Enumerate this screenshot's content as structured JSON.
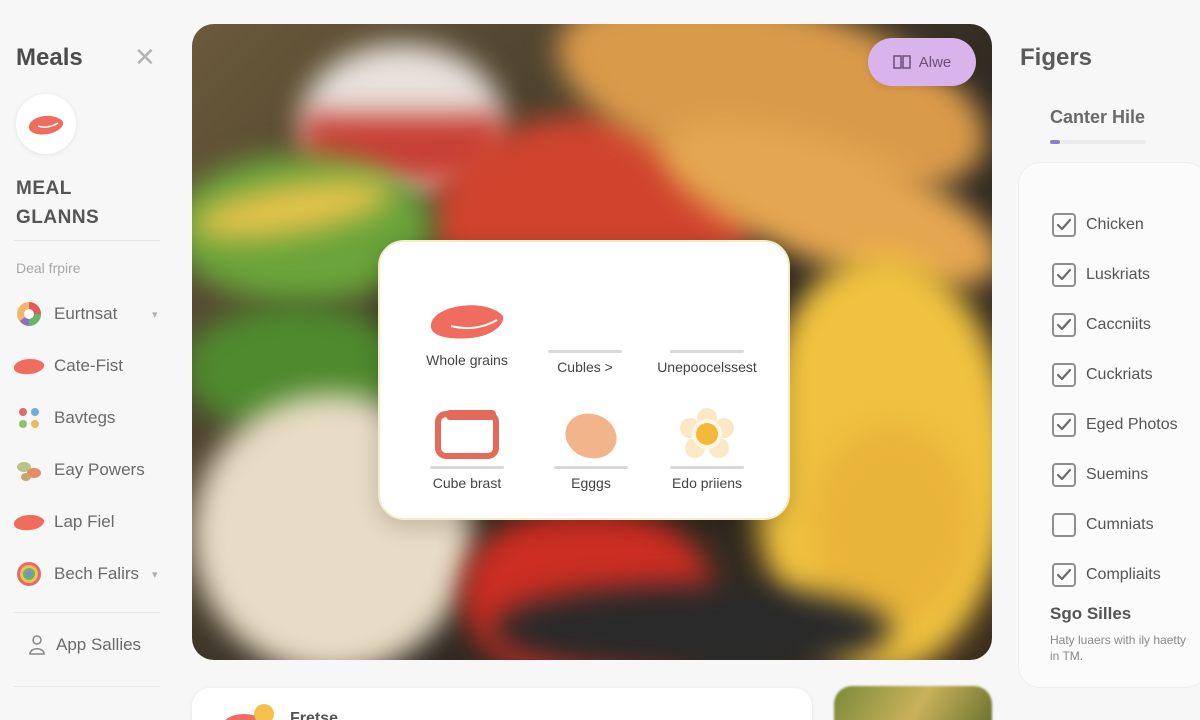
{
  "sidebar": {
    "title": "Meals",
    "heading": "MEAL GLANNS",
    "section_label": "Deal frpire",
    "items": [
      {
        "label": "Eurtnsat",
        "icon": "pie-chart-icon",
        "has_chevron": true
      },
      {
        "label": "Cate-Fist",
        "icon": "salmon-icon",
        "has_chevron": false
      },
      {
        "label": "Bavtegs",
        "icon": "grid-dots-icon",
        "has_chevron": false
      },
      {
        "label": "Eay Powers",
        "icon": "veggies-icon",
        "has_chevron": false
      },
      {
        "label": "Lap Fiel",
        "icon": "fish-icon",
        "has_chevron": false
      },
      {
        "label": "Bech Falirs",
        "icon": "rainbow-circle-icon",
        "has_chevron": true
      }
    ],
    "settings_label": "App Sallies"
  },
  "hero": {
    "tag_label": "Alwe"
  },
  "card": {
    "items": [
      {
        "label": "Whole grains",
        "icon": "salmon-icon"
      },
      {
        "label": "Cubles >",
        "icon": ""
      },
      {
        "label": "Unepoocelssest",
        "icon": ""
      },
      {
        "label": "Cube brast",
        "icon": "cube-frame-icon"
      },
      {
        "label": "Egggs",
        "icon": "egg-icon"
      },
      {
        "label": "Edo priiens",
        "icon": "flower-icon"
      }
    ]
  },
  "right_panel": {
    "title": "Figers",
    "subtitle": "Canter Hile",
    "progress": 0.1,
    "checklist": [
      {
        "label": "Chicken",
        "checked": true
      },
      {
        "label": "Luskriats",
        "checked": true
      },
      {
        "label": "Caccniits",
        "checked": true
      },
      {
        "label": "Cuckriats",
        "checked": true
      },
      {
        "label": "Eged Photos",
        "checked": true
      },
      {
        "label": "Suemins",
        "checked": true
      },
      {
        "label": "Cumniats",
        "checked": false
      },
      {
        "label": "Compliaits",
        "checked": true
      }
    ],
    "note_title": "Sgo Silles",
    "note_text": "Haty luaers with ily haetty in TM."
  },
  "bottom": {
    "label": "Fretse"
  },
  "colors": {
    "accent_purple": "#d8b3ec",
    "salmon": "#ee6d5e",
    "check_border": "#8e8e8e"
  }
}
